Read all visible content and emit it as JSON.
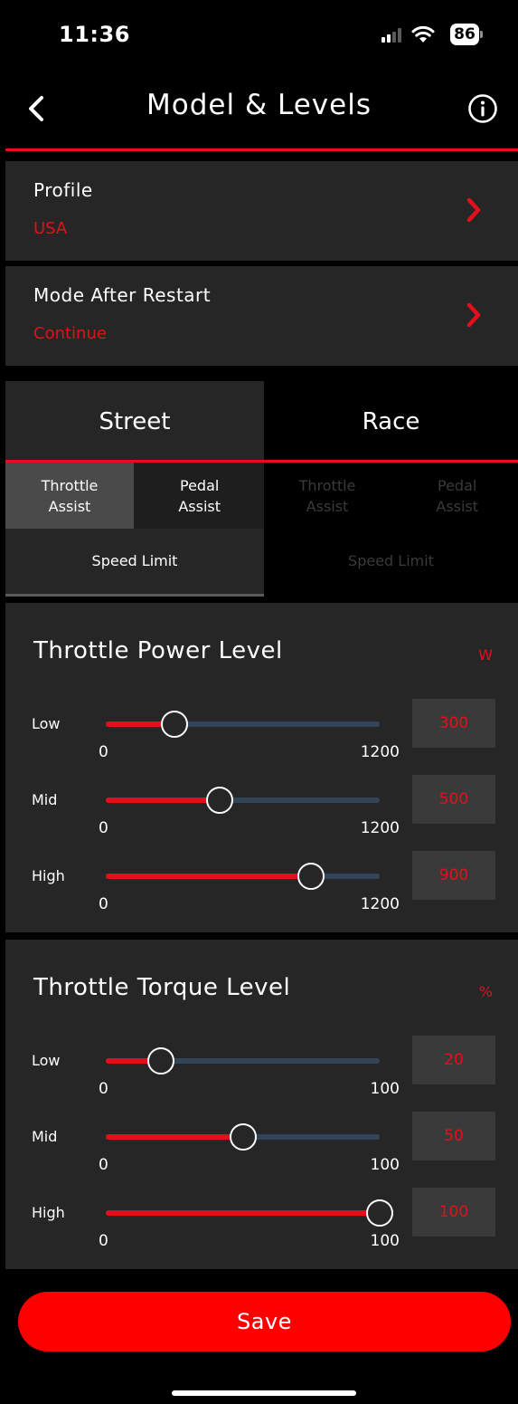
{
  "status_bar": {
    "time": "11:36",
    "battery": "86"
  },
  "nav": {
    "title": "Model & Levels"
  },
  "profile": {
    "label": "Profile",
    "value": "USA"
  },
  "restart": {
    "label": "Mode After Restart",
    "value": "Continue"
  },
  "modes": {
    "street": "Street",
    "race": "Race"
  },
  "subtabs": {
    "street_throttle": "Throttle\nAssist",
    "street_pedal": "Pedal\nAssist",
    "race_throttle": "Throttle\nAssist",
    "race_pedal": "Pedal\nAssist",
    "street_speed": "Speed Limit",
    "race_speed": "Speed Limit"
  },
  "power": {
    "title": "Throttle Power Level",
    "unit": "W",
    "min": "0",
    "max": "1200",
    "sliders": [
      {
        "label": "Low",
        "value": "300",
        "fraction": 0.25
      },
      {
        "label": "Mid",
        "value": "500",
        "fraction": 0.4167
      },
      {
        "label": "High",
        "value": "900",
        "fraction": 0.75
      }
    ]
  },
  "torque": {
    "title": "Throttle Torque Level",
    "unit": "%",
    "min": "0",
    "max": "100",
    "sliders": [
      {
        "label": "Low",
        "value": "20",
        "fraction": 0.2
      },
      {
        "label": "Mid",
        "value": "50",
        "fraction": 0.5
      },
      {
        "label": "High",
        "value": "100",
        "fraction": 1.0
      }
    ]
  },
  "save": {
    "label": "Save"
  },
  "colors": {
    "accent": "#e3101b",
    "panel": "#262626",
    "track": "#324558",
    "save": "#ff0000"
  }
}
